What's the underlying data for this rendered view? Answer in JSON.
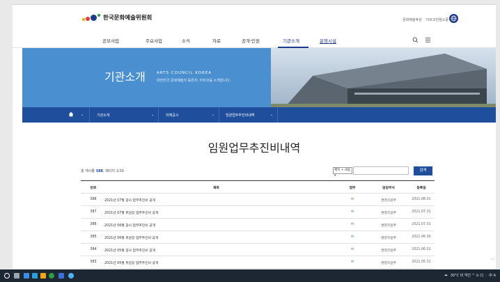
{
  "header": {
    "org_name": "한국문화예술위원회",
    "util_links": [
      "문화예술후원",
      "아르코한창소풍"
    ]
  },
  "gnb": {
    "items": [
      "공모사업",
      "주요사업",
      "소식",
      "자료",
      "공개·민원",
      "기관소개",
      "운영시설"
    ],
    "active": "기관소개"
  },
  "banner": {
    "title": "기관소개",
    "english": "ARTS COUNCIL KOREA",
    "desc": "대한민국 문화예술의 동반자, 아르코를 소개합니다."
  },
  "breadcrumb": {
    "home_icon": "home-icon",
    "items": [
      "기관소개",
      "자체공시",
      "임원업무추진비내역"
    ]
  },
  "page_title": "임원업무추진비내역",
  "list": {
    "total_prefix": "총 게시물 ",
    "total_count": "388",
    "total_suffix": ", 페이지 1/39",
    "search_select": "제목 + 내용",
    "search_placeholder": "",
    "search_button": "검색",
    "columns": [
      "번호",
      "제목",
      "첨부",
      "담당부서",
      "등록일"
    ],
    "rows": [
      {
        "no": "388",
        "title": "2021년 07월 감사 업무추진비 공개",
        "att": "✉",
        "dept": "경영지원부",
        "date": "2021.08.01"
      },
      {
        "no": "387",
        "title": "2021년 07월 위원장 업무추진비 공개",
        "att": "✉",
        "dept": "경영지원부",
        "date": "2021.07.31"
      },
      {
        "no": "386",
        "title": "2021년 06월 감사 업무추진비 공개",
        "att": "✉",
        "dept": "경영지원부",
        "date": "2021.07.01"
      },
      {
        "no": "385",
        "title": "2021년 06월 위원장 업무추진비 공개",
        "att": "✉",
        "dept": "경영지원부",
        "date": "2021.06.30"
      },
      {
        "no": "384",
        "title": "2021년 05월 감사 업무추진비 공개",
        "att": "✉",
        "dept": "경영지원부",
        "date": "2021.06.01"
      },
      {
        "no": "383",
        "title": "2021년 05월 위원장 업무추진비 공개",
        "att": "✉",
        "dept": "경영지원부",
        "date": "2021.05.31"
      }
    ]
  },
  "taskbar": {
    "tray_text": "30°C 비 약간 ^ ⊙ 口 ㆍ 中 A",
    "icons": [
      "windows-icon",
      "search-icon",
      "task-view-icon",
      "file-explorer-icon",
      "edge-icon",
      "store-icon",
      "chrome-icon",
      "app-icon"
    ]
  },
  "colors": {
    "brand": "#1f4f9c",
    "banner": "#4a8fd0",
    "attachment": "#3f9a3f"
  }
}
